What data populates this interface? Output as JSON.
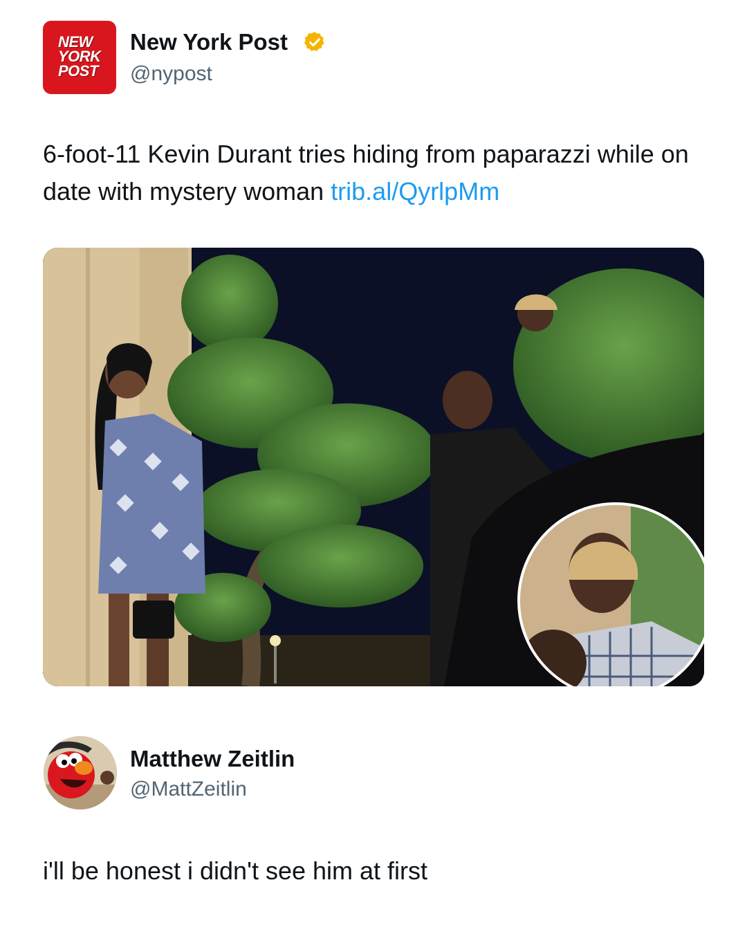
{
  "tweet_1": {
    "avatar_logo_text": "NEW\nYORK\nPOST",
    "display_name": "New York Post",
    "handle": "@nypost",
    "verified": true,
    "verified_badge_color": "#f4b400",
    "text": "6-foot-11 Kevin Durant tries hiding from paparazzi while on date with mystery woman ",
    "link_text": "trib.al/QyrlpMm",
    "link_color": "#1d9bf0",
    "brand_color": "#d9161e"
  },
  "tweet_2": {
    "display_name": "Matthew Zeitlin",
    "handle": "@MattZeitlin",
    "text": "i'll be honest i didn't see him at first",
    "avatar_icon": "elmo-avatar-icon"
  }
}
